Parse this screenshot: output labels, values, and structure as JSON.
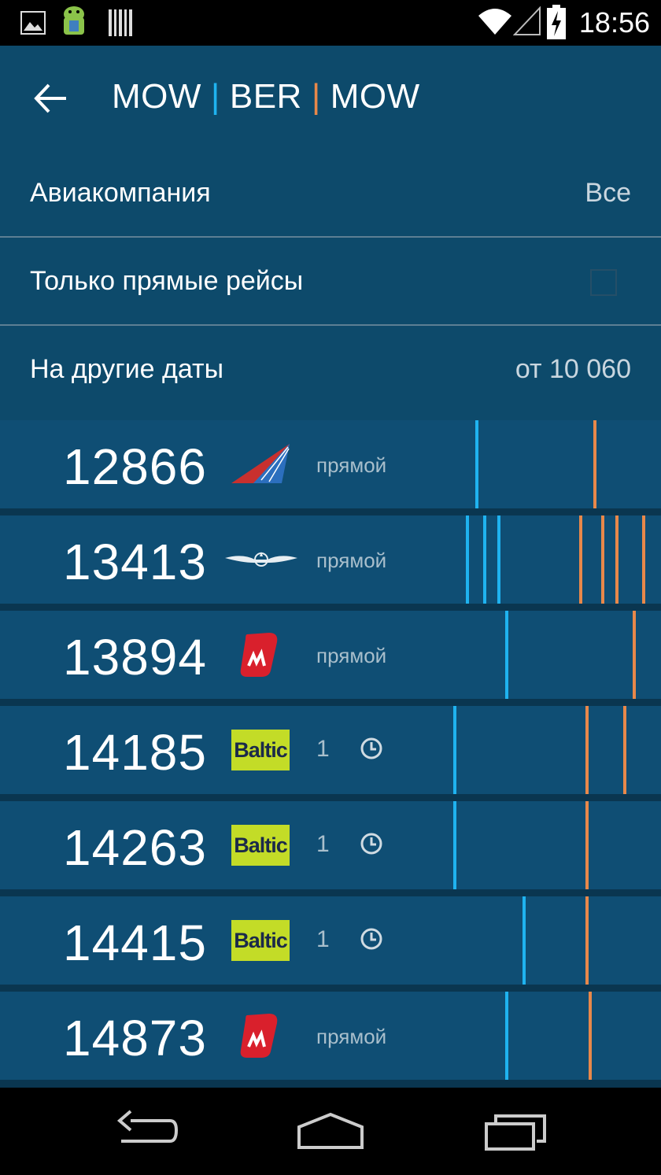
{
  "status_bar": {
    "time": "18:56",
    "icons": [
      "image-icon",
      "android-icon",
      "barcode-icon",
      "wifi-icon",
      "signal-icon",
      "battery-charging-icon"
    ]
  },
  "app_bar": {
    "back_icon": "arrow-left-icon",
    "route": {
      "from": "MOW",
      "sep1": "|",
      "to": "BER",
      "sep2": "|",
      "back": "MOW"
    },
    "colors": {
      "sep1": "#1fb3f0",
      "sep2": "#e8884a"
    }
  },
  "filters": {
    "airline": {
      "label": "Авиакомпания",
      "value": "Все"
    },
    "direct_only": {
      "label": "Только прямые рейсы",
      "checked": false
    },
    "other_dates": {
      "label": "На другие даты",
      "value": "от 10 060"
    }
  },
  "results": [
    {
      "price": "12866",
      "airline_logo": "transaero-logo",
      "stop_text": "прямой",
      "depart_marks_x": [
        604
      ],
      "return_marks_x": [
        754
      ]
    },
    {
      "price": "13413",
      "airline_logo": "aeroflot-logo",
      "stop_text": "прямой",
      "depart_marks_x": [
        592,
        614,
        632
      ],
      "return_marks_x": [
        736,
        764,
        782,
        816
      ]
    },
    {
      "price": "13894",
      "airline_logo": "airberlin-logo",
      "stop_text": "прямой",
      "depart_marks_x": [
        642
      ],
      "return_marks_x": [
        804
      ]
    },
    {
      "price": "14185",
      "airline_logo": "baltic-logo",
      "logo_text": "Baltic",
      "stops": "1",
      "stop_icon": "clock-icon",
      "depart_marks_x": [
        576
      ],
      "return_marks_x": [
        744,
        792
      ]
    },
    {
      "price": "14263",
      "airline_logo": "baltic-logo",
      "logo_text": "Baltic",
      "stops": "1",
      "stop_icon": "clock-icon",
      "depart_marks_x": [
        576
      ],
      "return_marks_x": [
        744
      ]
    },
    {
      "price": "14415",
      "airline_logo": "baltic-logo",
      "logo_text": "Baltic",
      "stops": "1",
      "stop_icon": "clock-icon",
      "depart_marks_x": [
        664
      ],
      "return_marks_x": [
        744
      ]
    },
    {
      "price": "14873",
      "airline_logo": "airberlin-logo",
      "stop_text": "прямой",
      "depart_marks_x": [
        642
      ],
      "return_marks_x": [
        748
      ]
    }
  ],
  "nav_bar": {
    "icons": [
      "back-nav-icon",
      "home-nav-icon",
      "recents-nav-icon"
    ]
  }
}
